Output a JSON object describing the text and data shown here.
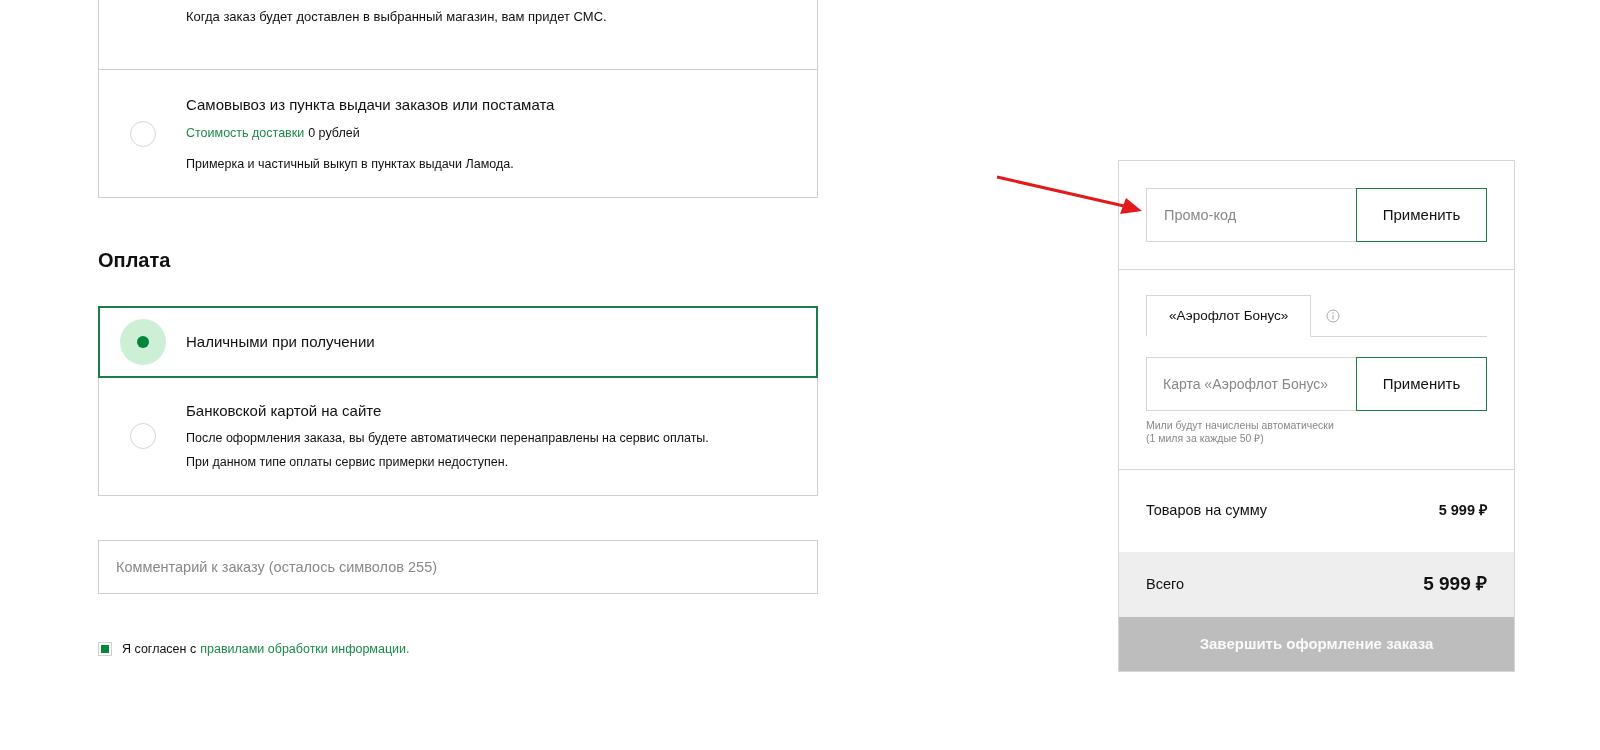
{
  "delivery": {
    "options": [
      {
        "kind": "cut",
        "note": "Когда заказ будет доставлен в выбранный магазин, вам придет СМС."
      },
      {
        "kind": "full",
        "selected": false,
        "title": "Самовывоз из пункта выдачи заказов или постамата",
        "cost_label": "Стоимость доставки",
        "cost_value": "0 рублей",
        "note": "Примерка и частичный выкуп в пунктах выдачи Ламода."
      }
    ]
  },
  "payment": {
    "heading": "Оплата",
    "options": [
      {
        "selected": true,
        "title": "Наличными при получении"
      },
      {
        "selected": false,
        "title": "Банковской картой на сайте",
        "notes": [
          "После оформления заказа, вы будете автоматически перенаправлены на сервис оплаты.",
          "При данном типе оплаты сервис примерки недоступен."
        ]
      }
    ]
  },
  "comment": {
    "placeholder": "Комментарий к заказу (осталось символов 255)"
  },
  "consent": {
    "checked": true,
    "text": "Я согласен с",
    "link": "правилами обработки информации."
  },
  "summary": {
    "promo": {
      "placeholder": "Промо-код",
      "button": "Применить"
    },
    "bonus_tabs": [
      {
        "label": "«Аэрофлот Бонус»",
        "selected": true
      }
    ],
    "bonus_card": {
      "placeholder": "Карта «Аэрофлот Бонус»",
      "button": "Применить"
    },
    "bonus_hint": [
      "Мили будут начислены автоматически",
      "(1 миля за каждые 50 ₽)"
    ],
    "goods": {
      "label": "Товаров на сумму",
      "value": "5 999 ₽"
    },
    "total": {
      "label": "Всего",
      "value": "5 999 ₽"
    },
    "submit": {
      "label": "Завершить оформление заказа",
      "disabled": true
    }
  }
}
